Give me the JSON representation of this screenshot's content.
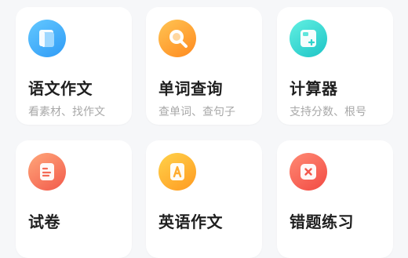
{
  "cards": [
    {
      "title": "语文作文",
      "subtitle": "看素材、找作文",
      "icon": "notebook-icon",
      "color": "#3aa8f8"
    },
    {
      "title": "单词查询",
      "subtitle": "查单词、查句子",
      "icon": "search-bubble-icon",
      "color": "#ff9a2a"
    },
    {
      "title": "计算器",
      "subtitle": "支持分数、根号",
      "icon": "calculator-icon",
      "color": "#2fd6d2"
    },
    {
      "title": "试卷",
      "subtitle": "",
      "icon": "exam-paper-icon",
      "color": "#f56b56"
    },
    {
      "title": "英语作文",
      "subtitle": "",
      "icon": "letter-a-icon",
      "color": "#ffb02e"
    },
    {
      "title": "错题练习",
      "subtitle": "",
      "icon": "wrong-answer-icon",
      "color": "#f5584c"
    }
  ]
}
